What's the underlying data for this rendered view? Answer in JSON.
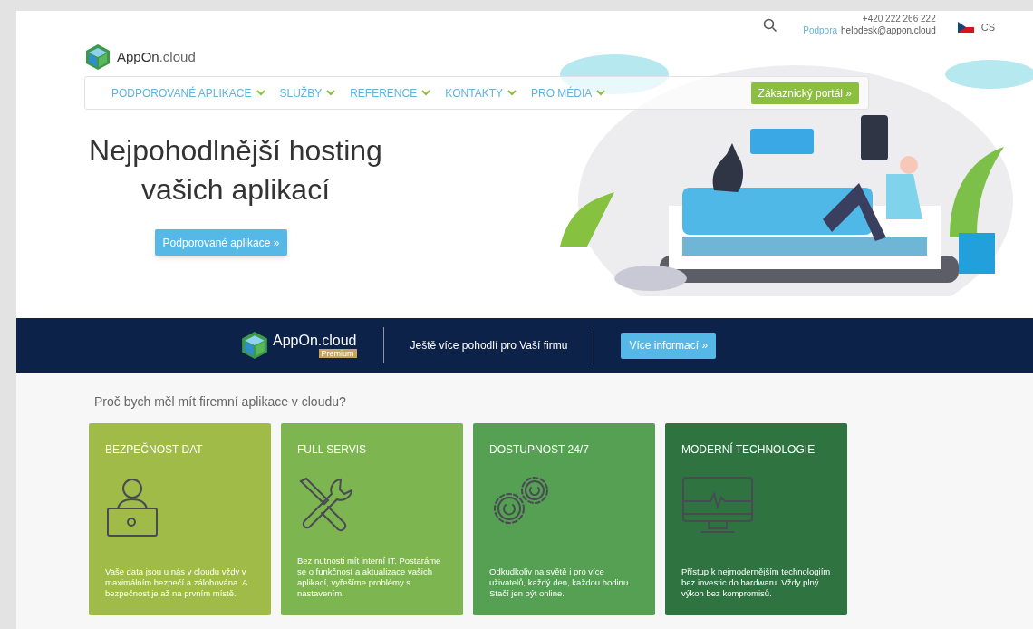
{
  "topbar": {
    "phone": "+420 222 266 222",
    "support_label": "Podpora",
    "support_email": "helpdesk@appon.cloud",
    "language": "CS"
  },
  "logo": {
    "brand": "AppOn",
    "suffix": ".cloud"
  },
  "nav": {
    "items": [
      {
        "label": "PODPOROVANÉ APLIKACE"
      },
      {
        "label": "SLUŽBY"
      },
      {
        "label": "REFERENCE"
      },
      {
        "label": "KONTAKTY"
      },
      {
        "label": "PRO MÉDIA"
      }
    ],
    "portal_button": "Zákaznický portál »"
  },
  "hero": {
    "title_lines": [
      "Nejpohodlnější hosting",
      "vašich aplikací"
    ],
    "button": "Podporované aplikace »"
  },
  "banner": {
    "brand": "AppOn",
    "suffix": ".cloud",
    "badge": "Premium",
    "text": "Ještě více pohodlí pro Vaší firmu",
    "button": "Více informací »"
  },
  "question": "Proč bych měl mít firemní aplikace v cloudu?",
  "cards": [
    {
      "title": "BEZPEČNOST DAT",
      "kind": "person-laptop",
      "color": "#a0bb48",
      "text": "Vaše data jsou u nás v cloudu vždy v maximálním bezpečí a zálohována. A bezpečnost je až na prvním místě."
    },
    {
      "title": "FULL SERVIS",
      "kind": "tools",
      "color": "#7db650",
      "text": "Bez nutnosti mít interní IT. Postaráme se o funkčnost a aktualizace vašich aplikací, vyřešíme problémy s nastavením."
    },
    {
      "title": "DOSTUPNOST 24/7",
      "kind": "gears",
      "color": "#55a052",
      "text": "Odkudkoliv na světě i pro více uživatelů, každý den, každou hodinu. Stačí jen být online."
    },
    {
      "title": "MODERNÍ TECHNOLOGIE",
      "kind": "monitor",
      "color": "#2f7440",
      "text": "Přístup k nejmodernějším technologiím bez investic do hardwaru. Vždy plný výkon bez kompromisů."
    }
  ]
}
